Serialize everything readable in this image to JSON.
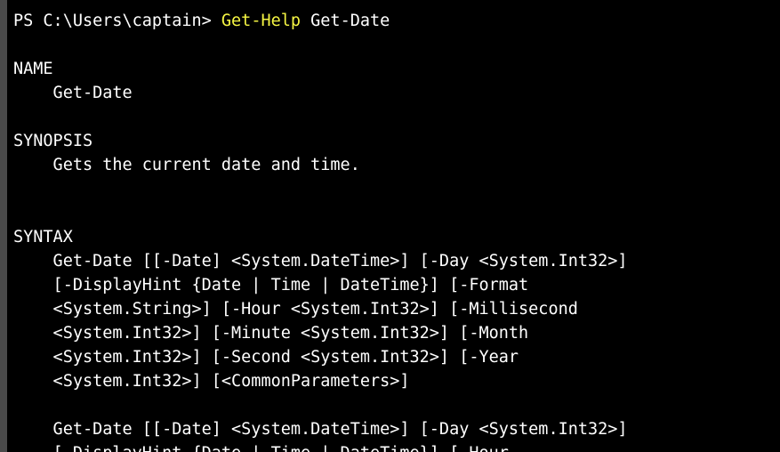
{
  "window": {
    "type": "powershell-terminal",
    "colors": {
      "background": "#000000",
      "text": "#ffffff",
      "command": "#f5f543",
      "left_edge": "#4a4a4a"
    }
  },
  "prompt": {
    "prefix": "PS C:\\Users\\captain> ",
    "command": "Get-Help",
    "argument": " Get-Date"
  },
  "help": {
    "name_header": "NAME",
    "name_value": "    Get-Date",
    "synopsis_header": "SYNOPSIS",
    "synopsis_value": "    Gets the current date and time.",
    "syntax_header": "SYNTAX",
    "syntax_block_1": [
      "    Get-Date [[-Date] <System.DateTime>] [-Day <System.Int32>]",
      "    [-DisplayHint {Date | Time | DateTime}] [-Format",
      "    <System.String>] [-Hour <System.Int32>] [-Millisecond",
      "    <System.Int32>] [-Minute <System.Int32>] [-Month",
      "    <System.Int32>] [-Second <System.Int32>] [-Year",
      "    <System.Int32>] [<CommonParameters>]"
    ],
    "syntax_block_2": [
      "    Get-Date [[-Date] <System.DateTime>] [-Day <System.Int32>]",
      "    [-DisplayHint {Date | Time | DateTime}] [-Hour"
    ]
  }
}
